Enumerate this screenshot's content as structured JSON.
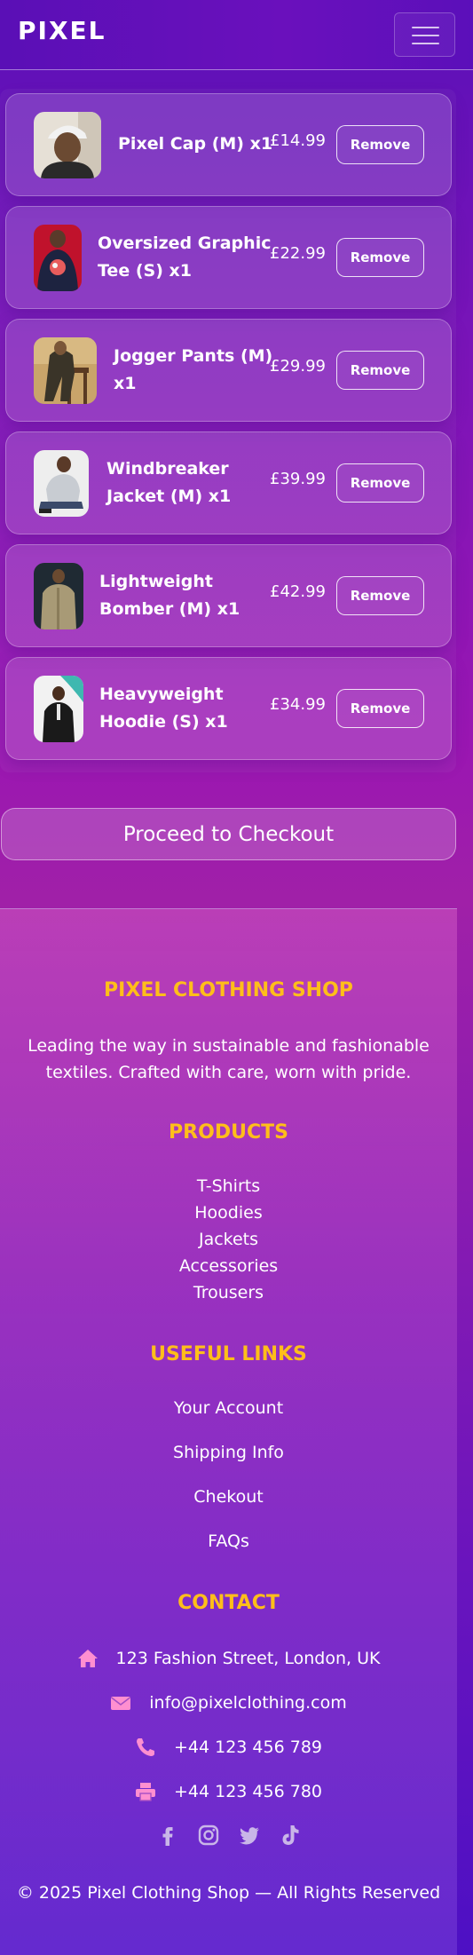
{
  "navbar": {
    "brand": "PIXEL",
    "menu_icon": "hamburger-menu-icon"
  },
  "cart": {
    "items": [
      {
        "name_line1": "Pixel Cap (M) x1",
        "name_line2": "",
        "price": "£14.99",
        "remove_label": "Remove"
      },
      {
        "name_line1": "Oversized Graphic",
        "name_line2": "Tee (S) x1",
        "price": "£22.99",
        "remove_label": "Remove"
      },
      {
        "name_line1": "Jogger Pants (M)",
        "name_line2": "x1",
        "price": "£29.99",
        "remove_label": "Remove"
      },
      {
        "name_line1": "Windbreaker",
        "name_line2": "Jacket (M) x1",
        "price": "£39.99",
        "remove_label": "Remove"
      },
      {
        "name_line1": "Lightweight",
        "name_line2": "Bomber (M) x1",
        "price": "£42.99",
        "remove_label": "Remove"
      },
      {
        "name_line1": "Heavyweight",
        "name_line2": "Hoodie (S) x1",
        "price": "£34.99",
        "remove_label": "Remove"
      }
    ],
    "checkout_label": "Proceed to Checkout"
  },
  "footer": {
    "shop_title": "PIXEL CLOTHING SHOP",
    "description_line1": "Leading the way in sustainable and fashionable",
    "description_line2": "textiles. Crafted with care, worn with pride.",
    "products_title": "PRODUCTS",
    "products": [
      "T-Shirts",
      "Hoodies",
      "Jackets",
      "Accessories",
      "Trousers"
    ],
    "links_title": "USEFUL LINKS",
    "links": [
      "Your Account",
      "Shipping Info",
      "Chekout",
      "FAQs"
    ],
    "contact_title": "CONTACT",
    "contact": [
      {
        "icon": "home-icon",
        "text": "123 Fashion Street, London, UK"
      },
      {
        "icon": "envelope-icon",
        "text": "info@pixelclothing.com"
      },
      {
        "icon": "phone-icon",
        "text": "+44 123 456 789"
      },
      {
        "icon": "printer-icon",
        "text": "+44 123 456 780"
      }
    ],
    "social_icons": [
      "facebook-icon",
      "instagram-icon",
      "twitter-icon",
      "tiktok-icon"
    ],
    "copyright": "© 2025 Pixel Clothing Shop — All Rights Reserved"
  },
  "colors": {
    "accent_heading": "#ffbe1a",
    "contact_icon": "#ff8fd0",
    "social_icon": "#c9b6e8"
  }
}
